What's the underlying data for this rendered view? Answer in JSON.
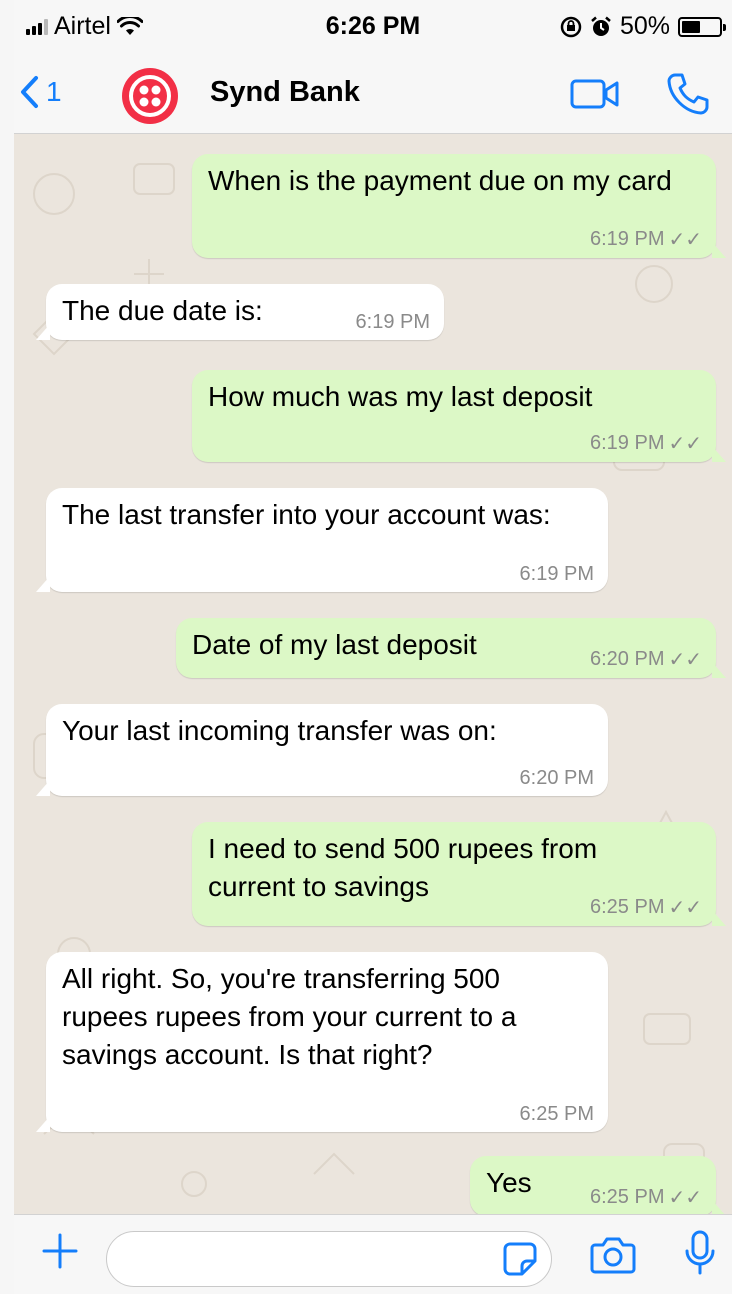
{
  "status_bar": {
    "carrier": "Airtel",
    "time": "6:26 PM",
    "battery": "50%",
    "battery_level": 0.5,
    "icons": [
      "signal-icon",
      "wifi-icon",
      "rotation-lock-icon",
      "alarm-icon",
      "battery-icon"
    ]
  },
  "header": {
    "back_count": "1",
    "contact_name": "Synd Bank",
    "avatar_color": "#f22f46",
    "icons": [
      "back-chevron-icon",
      "video-call-icon",
      "phone-icon"
    ]
  },
  "messages": [
    {
      "direction": "out",
      "text": "When is the payment due on my card",
      "time": "6:19 PM",
      "status": "read"
    },
    {
      "direction": "in",
      "text": "The due date is:",
      "time": "6:19 PM"
    },
    {
      "direction": "out",
      "text": "How much was my last deposit",
      "time": "6:19 PM",
      "status": "read"
    },
    {
      "direction": "in",
      "text": "The last transfer into your account was:",
      "time": "6:19 PM"
    },
    {
      "direction": "out",
      "text": "Date of my last deposit",
      "time": "6:20 PM",
      "status": "read"
    },
    {
      "direction": "in",
      "text": "Your last incoming transfer was on:",
      "time": "6:20 PM"
    },
    {
      "direction": "out",
      "text": "I need to send 500 rupees from current to savings",
      "time": "6:25 PM",
      "status": "read"
    },
    {
      "direction": "in",
      "text": "All right. So, you're transferring 500 rupees rupees from your current to a savings account. Is that right?",
      "time": "6:25 PM"
    },
    {
      "direction": "out",
      "text": "Yes",
      "time": "6:25 PM",
      "status": "read"
    }
  ],
  "input_bar": {
    "placeholder": "",
    "icons": [
      "plus-icon",
      "sticker-icon",
      "camera-icon",
      "microphone-icon"
    ]
  },
  "colors": {
    "accent": "#147efb",
    "outgoing_bubble": "#dcf8c6",
    "incoming_bubble": "#ffffff",
    "chat_background": "#ebe5dd"
  }
}
